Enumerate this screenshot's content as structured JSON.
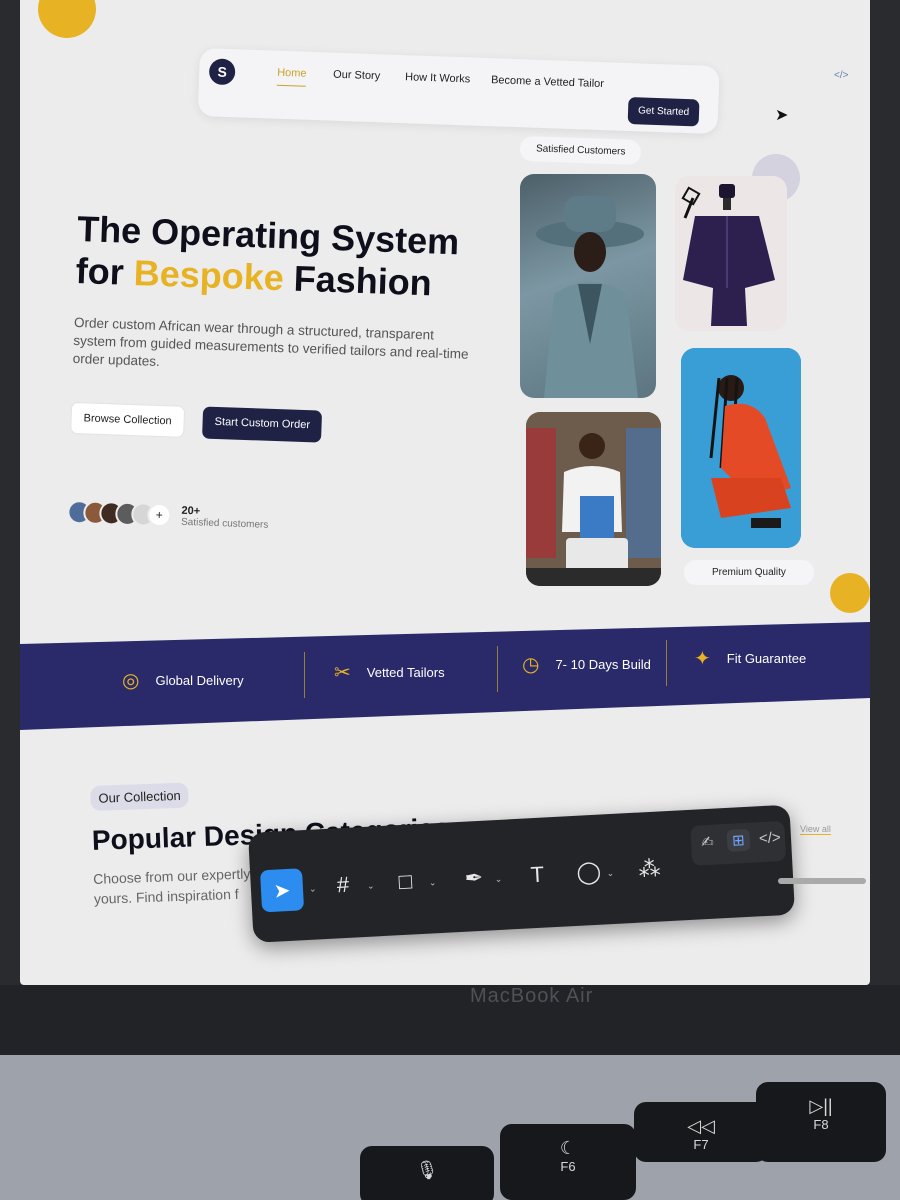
{
  "nav": {
    "logo": "S",
    "links": [
      "Home",
      "Our Story",
      "How It Works",
      "Become a Vetted Tailor"
    ],
    "cta": "Get Started"
  },
  "hero": {
    "title_line1": "The Operating System",
    "title_for": "for",
    "title_accent": "Bespoke",
    "title_end": "Fashion",
    "description": "Order custom African wear through a structured, transparent system from guided measurements to verified tailors and real-time order updates.",
    "btn_browse": "Browse Collection",
    "btn_order": "Start Custom Order",
    "customer_count": "20+",
    "customer_label": "Satisfied customers",
    "avatar_plus": "+"
  },
  "gallery": {
    "tag_top": "Satisfied Customers",
    "tag_bottom": "Premium Quality"
  },
  "features": [
    {
      "label": "Global Delivery",
      "icon": "globe-icon",
      "glyph": "◎"
    },
    {
      "label": "Vetted Tailors",
      "icon": "scissors-icon",
      "glyph": "✂"
    },
    {
      "label": "7- 10 Days Build",
      "icon": "clock-icon",
      "glyph": "◷"
    },
    {
      "label": "Fit Guarantee",
      "icon": "sparkle-icon",
      "glyph": "✦"
    }
  ],
  "collection": {
    "chip": "Our Collection",
    "title": "Popular Design Categories",
    "description": "Choose from our expertly designed base styles and make them yours. Find inspiration f",
    "view_all": "View all"
  },
  "toolbar": {
    "select": "➤",
    "frame": "#",
    "rect": "□",
    "pen": "✒",
    "text": "T",
    "comment": "◯",
    "components": "⁂",
    "draw": "✍",
    "dev": "⊞",
    "code": "</>",
    "caret": "⌄"
  },
  "laptop": {
    "brand": "MacBook Air",
    "keys": [
      {
        "glyph": "🎙",
        "label": ""
      },
      {
        "glyph": "☾",
        "label": "F6"
      },
      {
        "glyph": "◁◁",
        "label": "F7"
      },
      {
        "glyph": "▷||",
        "label": "F8"
      }
    ]
  },
  "colors": {
    "accent": "#e7b324",
    "navy": "#1f2245",
    "band": "#2a2a6a",
    "toolbar": "#232427",
    "select_blue": "#2d8cf0"
  }
}
